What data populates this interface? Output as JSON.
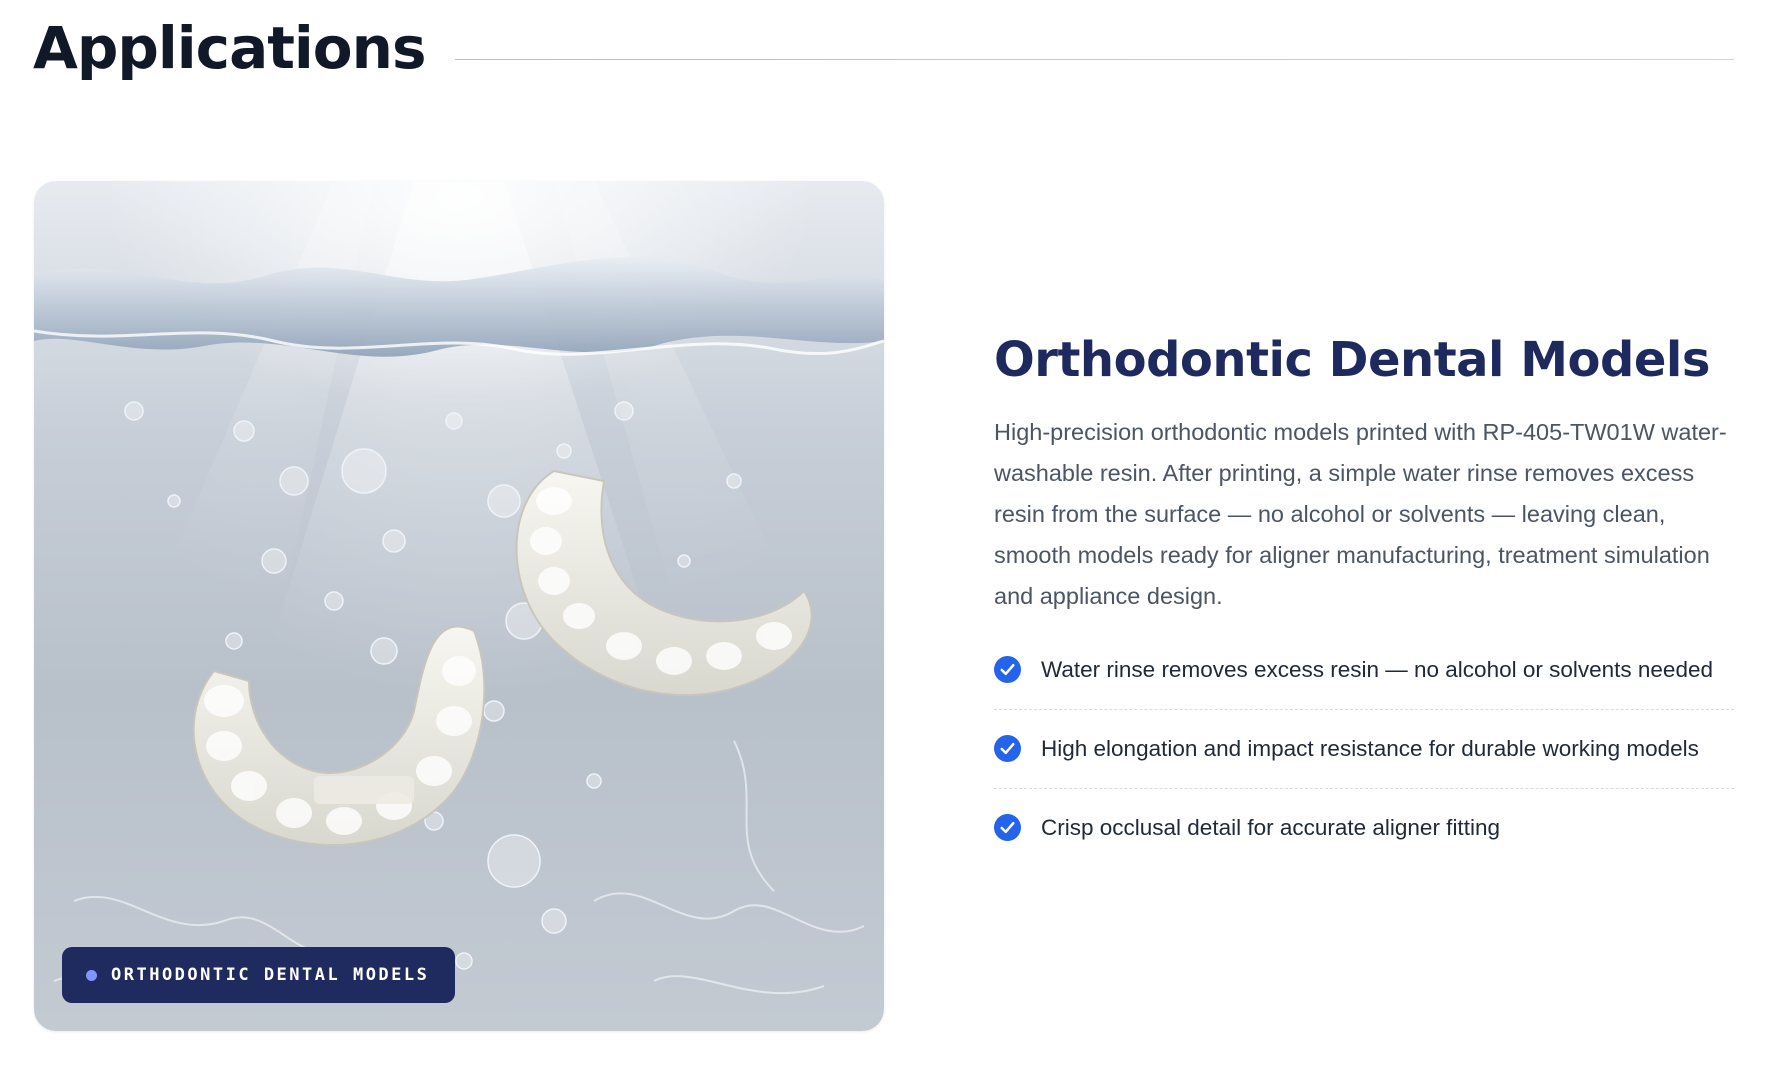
{
  "section": {
    "title": "Applications"
  },
  "media": {
    "badge_label": "ORTHODONTIC DENTAL MODELS",
    "image_alt_icon": "dental-models-in-water-image"
  },
  "content": {
    "title": "Orthodontic Dental Models",
    "description": "High-precision orthodontic models printed with RP-405-TW01W water-washable resin. After printing, a simple water rinse removes excess resin from the surface — no alcohol or solvents — leaving clean, smooth models ready for aligner manufacturing, treatment simulation and appliance design.",
    "features": [
      {
        "text": "Water rinse removes excess resin — no alcohol or solvents needed",
        "icon": "check-circle-icon"
      },
      {
        "text": "High elongation and impact resistance for durable working models",
        "icon": "check-circle-icon"
      },
      {
        "text": "Crisp occlusal detail for accurate aligner fitting",
        "icon": "check-circle-icon"
      }
    ]
  },
  "colors": {
    "heading": "#111827",
    "title_navy": "#1e2a5e",
    "badge_bg": "#1f2b5e",
    "badge_dot": "#7d96ff",
    "check": "#2563eb"
  }
}
